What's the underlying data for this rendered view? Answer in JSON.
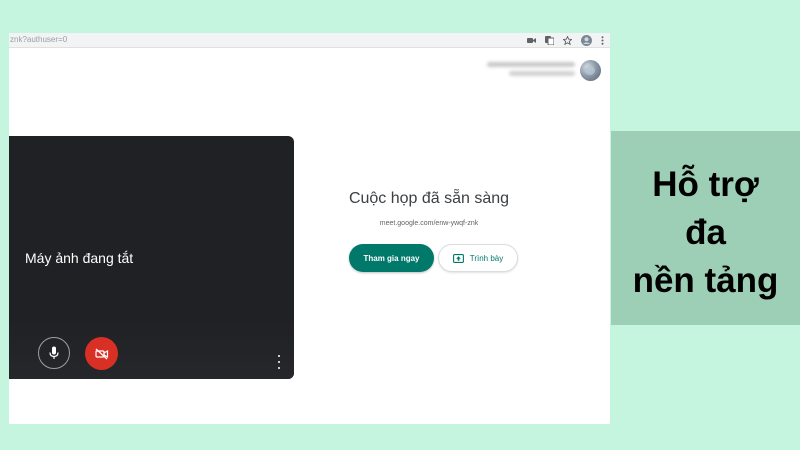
{
  "browser": {
    "url": "znk?authuser=0",
    "icons": [
      "camera-icon",
      "translate-icon",
      "star-icon",
      "profile-icon",
      "menu-icon"
    ]
  },
  "account": {
    "avatar": "user-avatar"
  },
  "preview": {
    "camera_off_text": "Máy ảnh đang tắt",
    "mic_icon": "microphone-icon",
    "camera_icon": "camera-off-icon",
    "more_icon": "more-vertical-icon"
  },
  "join": {
    "title": "Cuộc họp đã sẵn sàng",
    "meeting_link": "meet.google.com/enw-ywqf-znk",
    "join_label": "Tham gia ngay",
    "present_label": "Trình bày",
    "present_icon": "present-screen-icon"
  },
  "caption": {
    "lines": [
      "Hỗ trợ",
      "đa",
      "nền tảng"
    ]
  },
  "colors": {
    "page_background": "#c6f5df",
    "caption_background": "#9ccfb5",
    "join_button": "#00796b",
    "camera_off_button": "#d93025",
    "preview_background": "#202124"
  }
}
